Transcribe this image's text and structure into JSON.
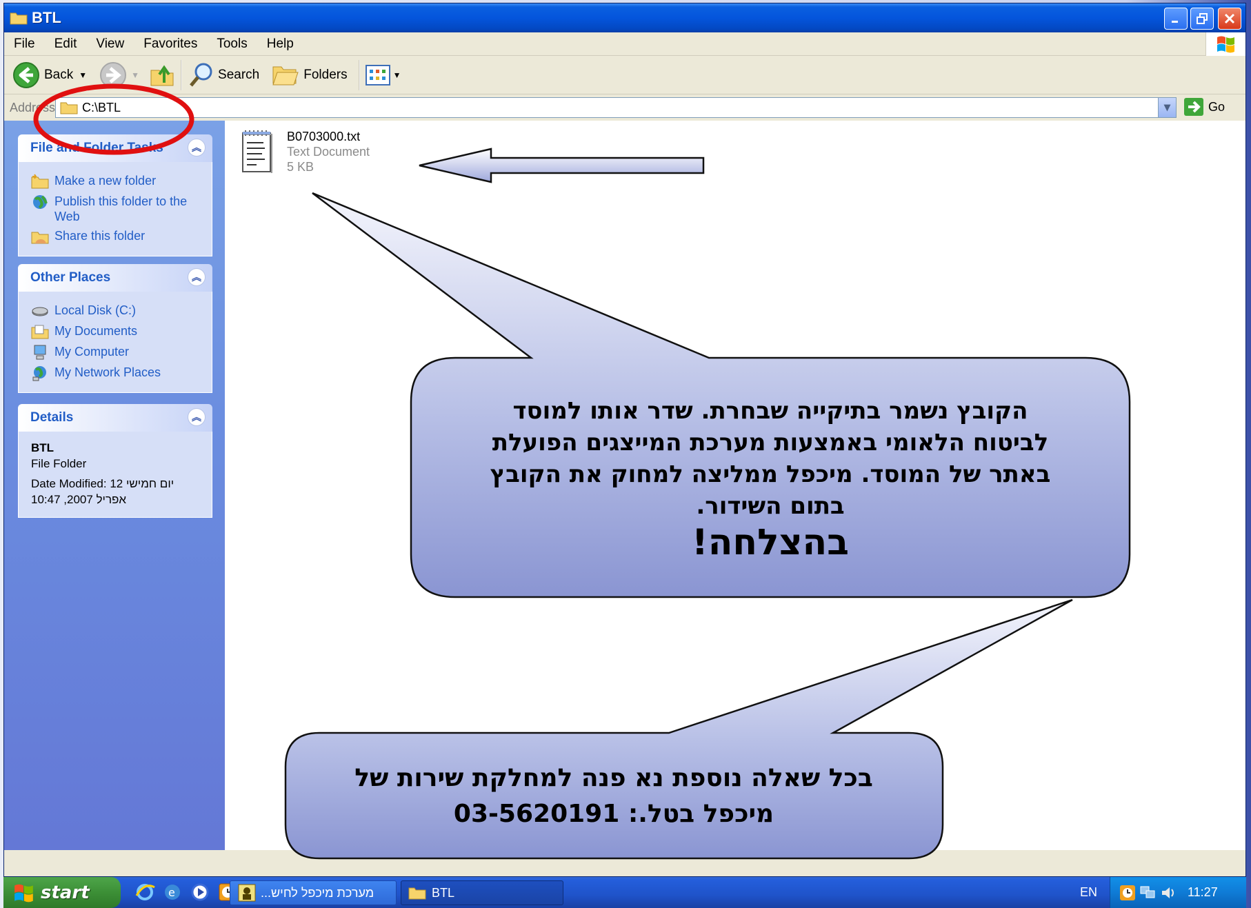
{
  "window": {
    "title": "BTL"
  },
  "menu": [
    "File",
    "Edit",
    "View",
    "Favorites",
    "Tools",
    "Help"
  ],
  "toolbar": {
    "back": "Back",
    "search": "Search",
    "folders": "Folders"
  },
  "address": {
    "label": "Address",
    "value": "C:\\BTL",
    "go": "Go"
  },
  "tasks_panel": {
    "title": "File and Folder Tasks",
    "items": [
      "Make a new folder",
      "Publish this folder to the Web",
      "Share this folder"
    ]
  },
  "other_places": {
    "title": "Other Places",
    "items": [
      "Local Disk (C:)",
      "My Documents",
      "My Computer",
      "My Network Places"
    ]
  },
  "details": {
    "title": "Details",
    "name": "BTL",
    "type": "File Folder",
    "modified_line1": "Date Modified: 12 יום חמישי",
    "modified_line2": "10:47 ,2007 אפריל"
  },
  "file": {
    "name": "B0703000.txt",
    "type": "Text Document",
    "size": "5 KB"
  },
  "callout_main": {
    "lines": [
      "הקובץ נשמר בתיקייה שבחרת. שדר אותו למוסד",
      "לביטוח הלאומי באמצעות מערכת המייצגים הפועלת",
      "באתר של המוסד. מיכפל ממליצה למחוק את הקובץ",
      "בתום השידור."
    ],
    "highlight": "בהצלחה!"
  },
  "callout_contact": {
    "lines": [
      "בכל שאלה נוספת נא פנה למחלקת שירות של",
      "מיכפל בטל.: 03-5620191"
    ]
  },
  "taskbar": {
    "start": "start",
    "task1": "מערכת מיכפל לחיש...",
    "task2": "BTL",
    "lang": "EN",
    "clock": "11:27"
  },
  "colors": {
    "titlebar": "#0455dc",
    "taskpane": "#6b8ee0",
    "callout": "#9aa4d8",
    "annotation": "#e01010"
  }
}
